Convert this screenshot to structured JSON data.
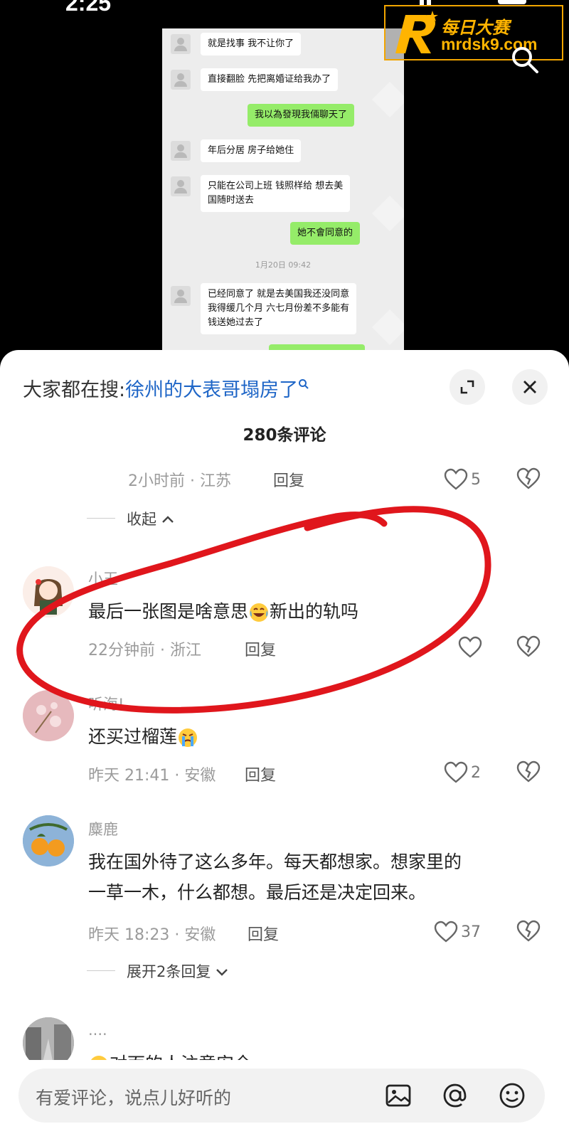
{
  "status": {
    "time": "2:25"
  },
  "watermark": {
    "site_name_cn": "每日大赛",
    "site_url": "mrdsk9.com"
  },
  "chat_image": {
    "messages": [
      {
        "side": "in",
        "text": "就是找事 我不让你了"
      },
      {
        "side": "in",
        "text": "直接翻脸 先把离婚证给我办了"
      },
      {
        "side": "out",
        "text": "我以為發現我倆聊天了"
      },
      {
        "side": "in",
        "text": "年后分居 房子给她住"
      },
      {
        "side": "in",
        "line1": "只能在公司上班 钱照样给 想去美",
        "line2": "国随时送去"
      },
      {
        "side": "out",
        "text": "她不會同意的"
      },
      {
        "side": "in",
        "line1": "已经同意了 就是去美国我还没同意",
        "line2": "我得缓几个月 六七月份差不多能有",
        "line3": "钱送她过去了"
      }
    ],
    "timestamp": "1月20日 09:42"
  },
  "sheet": {
    "search_prefix": "大家都在搜:",
    "search_hot": "徐州的大表哥塌房了",
    "comment_count": "280条评论"
  },
  "comments": [
    {
      "meta": "2小时前 · 江苏",
      "reply": "回复",
      "likes": "5",
      "fold": "收起"
    },
    {
      "user": "小玉",
      "text_before": "最后一张图是啥意思",
      "text_after": "新出的轨吗",
      "meta": "22分钟前 · 浙江",
      "reply": "回复",
      "likes": ""
    },
    {
      "user": "听海!",
      "text_before": "还买过榴莲",
      "meta": "昨天 21:41 · 安徽",
      "reply": "回复",
      "likes": "2"
    },
    {
      "user": "麋鹿",
      "line1": "我在国外待了这么多年。每天都想家。想家里的",
      "line2": "一草一木，什么都想。最后还是决定回来。",
      "meta": "昨天 18:23 · 安徽",
      "reply": "回复",
      "likes": "37",
      "expand": "展开2条回复"
    },
    {
      "user": "....",
      "text_partial": "对面的人注意安全"
    }
  ],
  "input": {
    "placeholder": "有爱评论，说点儿好听的"
  },
  "icons": [
    "search-icon",
    "expand-icon",
    "close-icon",
    "heart-icon",
    "broken-heart-icon",
    "chevron-up-icon",
    "chevron-down-icon",
    "image-icon",
    "at-icon",
    "emoji-icon"
  ],
  "colors": {
    "accent_link": "#1f66c7",
    "annotation_red": "#e0161c",
    "watermark_gold": "#ffb400"
  }
}
